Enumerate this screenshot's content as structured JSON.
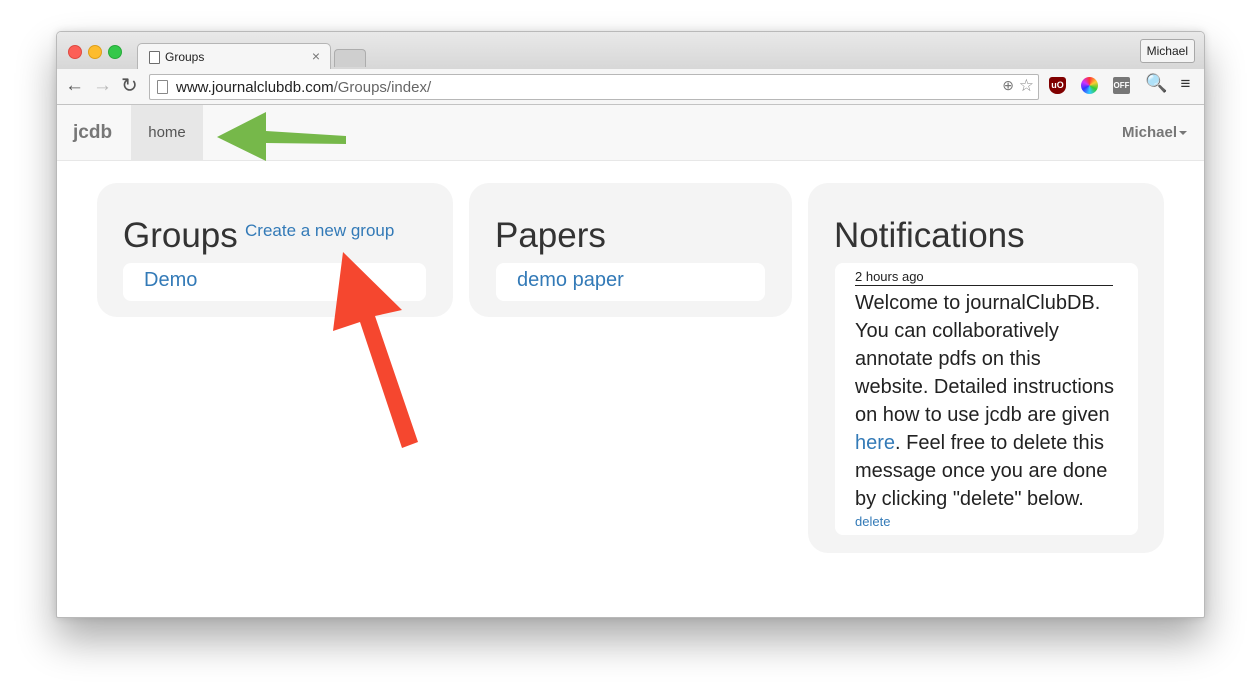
{
  "browser": {
    "tab_title": "Groups",
    "tab_close": "×",
    "profile_name": "Michael",
    "url_host": "www.journalclubdb.com",
    "url_path": "/Groups/index/",
    "back_glyph": "←",
    "forward_glyph": "→",
    "reload_glyph": "↻",
    "zoom_glyph": "⊕",
    "star_glyph": "☆",
    "ext_ublock": "uO",
    "ext_off": "OFF",
    "search_glyph": "🔍",
    "menu_glyph": "≡"
  },
  "nav": {
    "brand": "jcdb",
    "home": "home",
    "user": "Michael"
  },
  "groups": {
    "title": "Groups",
    "create_link": "Create a new group",
    "items": [
      "Demo"
    ]
  },
  "papers": {
    "title": "Papers",
    "items": [
      "demo paper"
    ]
  },
  "notifications": {
    "title": "Notifications",
    "time": "2 hours ago",
    "body_before": "Welcome to journalClubDB. You can collaboratively annotate pdfs on this website. Detailed instructions on how to use jcdb are given ",
    "link_text": "here",
    "body_after": ". Feel free to delete this message once you are done by clicking \"delete\" below.",
    "delete": "delete"
  },
  "annotations": {
    "green_arrow_color": "#76b84a",
    "red_arrow_color": "#f5472f"
  }
}
